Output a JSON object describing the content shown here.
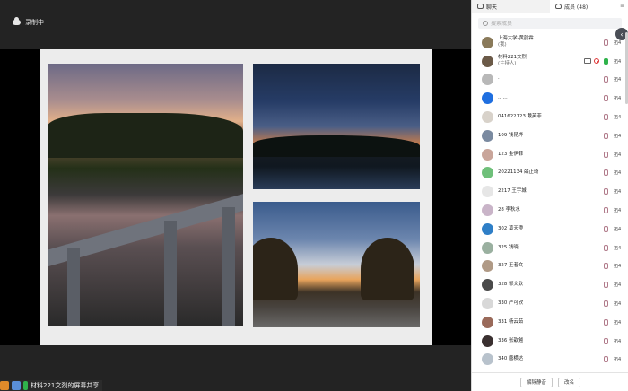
{
  "recording": {
    "label": "录制中"
  },
  "share_status": {
    "text": "材料221文烈的屏幕共享"
  },
  "panel": {
    "tabs": [
      {
        "label": "聊天"
      },
      {
        "label": "成员 (48)"
      }
    ],
    "search_placeholder": "搜索成员",
    "buttons": {
      "unmute_all": "解除静音",
      "rename": "改名"
    }
  },
  "members": [
    {
      "name": "上海大学-黄韵霖",
      "sub": "(我)",
      "label": "拓4",
      "avatar_color": "#8a7a5a"
    },
    {
      "name": "材料221文烈",
      "sub": "(主持人)",
      "label": "拓4",
      "avatar_color": "#6b5a48",
      "host": true
    },
    {
      "name": "·",
      "sub": "",
      "label": "拓4",
      "avatar_color": "#b8b8b8"
    },
    {
      "name": "……",
      "sub": "",
      "label": "拓4",
      "avatar_color": "#1f6fe0"
    },
    {
      "name": "041622123 戴英菲",
      "sub": "",
      "label": "拓4",
      "avatar_color": "#d8d2ca"
    },
    {
      "name": "109 钱昆烨",
      "sub": "",
      "label": "拓4",
      "avatar_color": "#7a8aa0"
    },
    {
      "name": "123 金伊菲",
      "sub": "",
      "label": "拓4",
      "avatar_color": "#c9a59a"
    },
    {
      "name": "20221134 薛正琦",
      "sub": "",
      "label": "拓4",
      "avatar_color": "#6fc07a"
    },
    {
      "name": "2217 王宇城",
      "sub": "",
      "label": "拓4",
      "avatar_color": "#e6e6e6"
    },
    {
      "name": "28 李秋水",
      "sub": "",
      "label": "拓4",
      "avatar_color": "#c9b4c8"
    },
    {
      "name": "302 葛天澄",
      "sub": "",
      "label": "拓4",
      "avatar_color": "#2f7fc7"
    },
    {
      "name": "325 钱晓",
      "sub": "",
      "label": "拓4",
      "avatar_color": "#9ab0a0"
    },
    {
      "name": "327 王者文",
      "sub": "",
      "label": "拓4",
      "avatar_color": "#b09a86"
    },
    {
      "name": "328 邬文钦",
      "sub": "",
      "label": "拓4",
      "avatar_color": "#4a4a4a"
    },
    {
      "name": "330 严可欣",
      "sub": "",
      "label": "拓4",
      "avatar_color": "#d8d8d8"
    },
    {
      "name": "331 杨云茹",
      "sub": "",
      "label": "拓4",
      "avatar_color": "#9a6a5a"
    },
    {
      "name": "336 张歆越",
      "sub": "",
      "label": "拓4",
      "avatar_color": "#3a3030"
    },
    {
      "name": "340 唐横达",
      "sub": "",
      "label": "拓4",
      "avatar_color": "#b8c2cc"
    }
  ]
}
